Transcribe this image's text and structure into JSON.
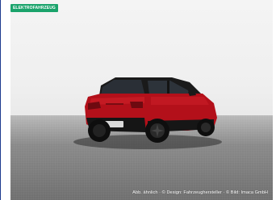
{
  "badge": {
    "label": "ELEKTROFAHRZEUG"
  },
  "photo": {
    "subject": "red-suv-rear-three-quarter-view",
    "caption": "Abb. ähnlich · © Design: Fahrzeughersteller · © Bild: Imaca GmbH"
  },
  "colors": {
    "badge_bg": "#1aa36b",
    "car_body": "#b3101a",
    "car_roof": "#1a1a1a",
    "floor": "#7a7a7a",
    "backdrop": "#f2f2f2"
  }
}
